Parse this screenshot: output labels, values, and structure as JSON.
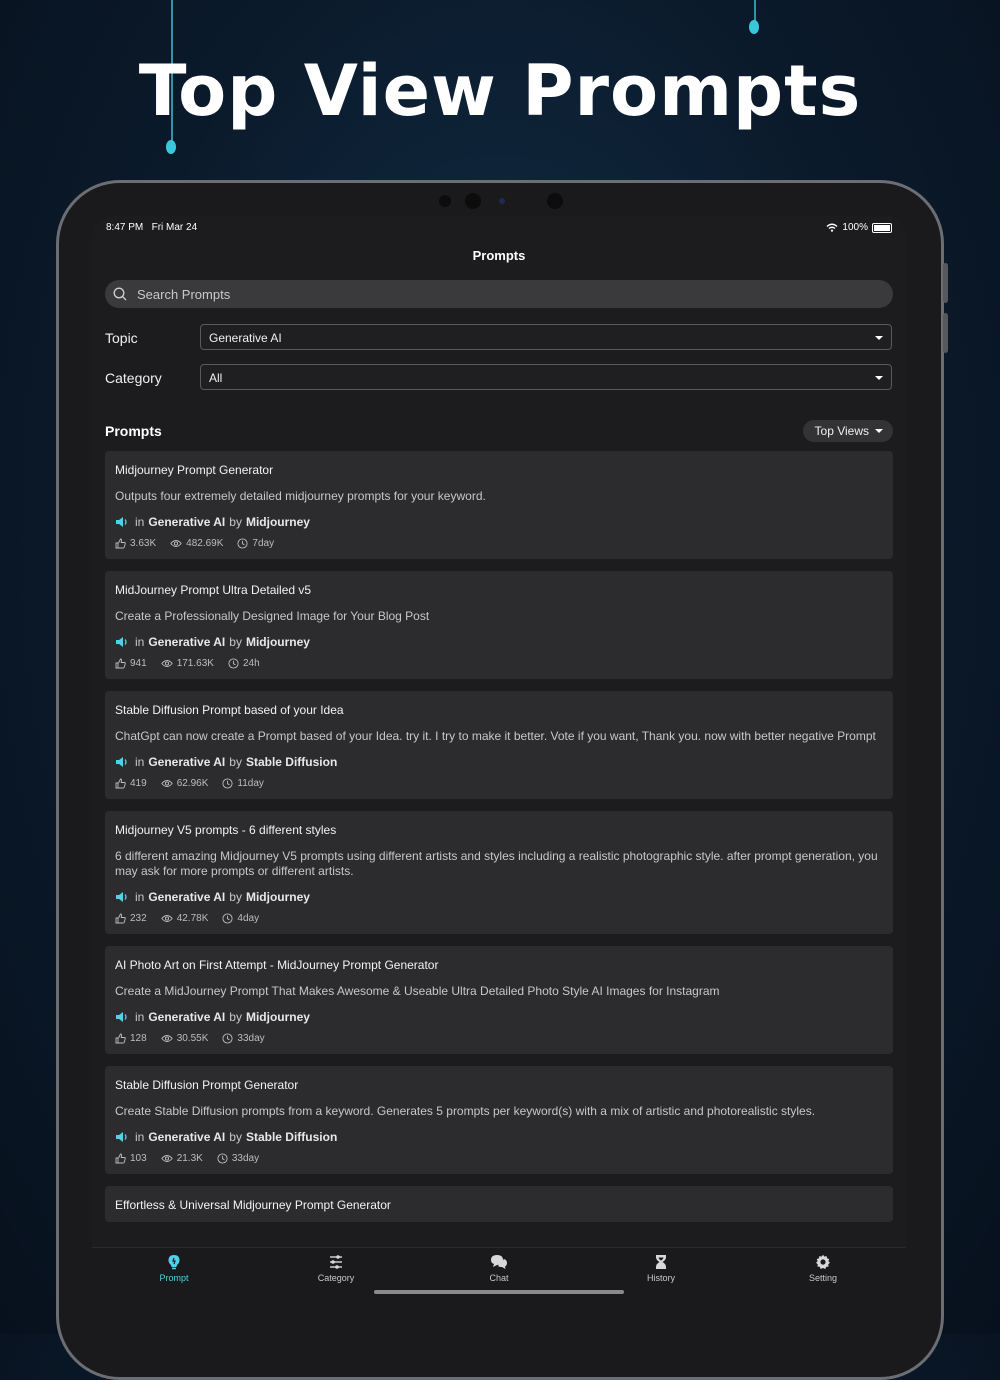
{
  "headline": "Top View Prompts",
  "status_bar": {
    "time": "8:47 PM",
    "date": "Fri Mar 24",
    "battery": "100%"
  },
  "nav": {
    "title": "Prompts"
  },
  "search": {
    "placeholder": "Search Prompts"
  },
  "filters": {
    "topic_label": "Topic",
    "topic_value": "Generative AI",
    "category_label": "Category",
    "category_value": "All"
  },
  "prompts_section": {
    "title": "Prompts",
    "sort_label": "Top Views"
  },
  "prompts": [
    {
      "title": "Midjourney Prompt Generator",
      "description": "Outputs four extremely detailed midjourney prompts for your keyword.",
      "in_label": "in",
      "topic": "Generative AI",
      "by_label": "by",
      "author": "Midjourney",
      "likes": "3.63K",
      "views": "482.69K",
      "age": "7day"
    },
    {
      "title": "MidJourney Prompt Ultra Detailed v5",
      "description": "Create a Professionally Designed Image for Your Blog Post",
      "in_label": "in",
      "topic": "Generative AI",
      "by_label": "by",
      "author": "Midjourney",
      "likes": "941",
      "views": "171.63K",
      "age": "24h"
    },
    {
      "title": "Stable Diffusion Prompt based of your Idea",
      "description": "ChatGpt can now create a Prompt based of your Idea. try it. I try to make it better. Vote if you want, Thank you. now with  better negative Prompt",
      "in_label": "in",
      "topic": "Generative AI",
      "by_label": "by",
      "author": "Stable Diffusion",
      "likes": "419",
      "views": "62.96K",
      "age": "11day"
    },
    {
      "title": "Midjourney V5 prompts - 6 different styles",
      "description": "6 different amazing Midjourney V5 prompts using different artists and styles including a realistic photographic style. after prompt generation, you may ask for more prompts or different artists.",
      "in_label": "in",
      "topic": "Generative AI",
      "by_label": "by",
      "author": "Midjourney",
      "likes": "232",
      "views": "42.78K",
      "age": "4day"
    },
    {
      "title": "AI Photo Art on First Attempt - MidJourney Prompt Generator",
      "description": "Create a MidJourney Prompt That Makes Awesome & Useable Ultra Detailed Photo Style AI Images for Instagram",
      "in_label": "in",
      "topic": "Generative AI",
      "by_label": "by",
      "author": "Midjourney",
      "likes": "128",
      "views": "30.55K",
      "age": "33day"
    },
    {
      "title": "Stable Diffusion Prompt Generator",
      "description": "Create Stable Diffusion prompts from a keyword. Generates 5 prompts per keyword(s) with a mix of artistic and photorealistic styles.",
      "in_label": "in",
      "topic": "Generative AI",
      "by_label": "by",
      "author": "Stable Diffusion",
      "likes": "103",
      "views": "21.3K",
      "age": "33day"
    },
    {
      "title": "Effortless & Universal Midjourney Prompt Generator",
      "description": "",
      "in_label": "",
      "topic": "",
      "by_label": "",
      "author": "",
      "likes": "",
      "views": "",
      "age": ""
    }
  ],
  "tabs": [
    {
      "label": "Prompt",
      "icon": "bulb-icon",
      "active": true
    },
    {
      "label": "Category",
      "icon": "sliders-icon",
      "active": false
    },
    {
      "label": "Chat",
      "icon": "chat-icon",
      "active": false
    },
    {
      "label": "History",
      "icon": "hourglass-icon",
      "active": false
    },
    {
      "label": "Setting",
      "icon": "gear-icon",
      "active": false
    }
  ],
  "colors": {
    "accent": "#4fd2e6",
    "card": "#2c2c2e",
    "screen": "#1c1c1e"
  }
}
